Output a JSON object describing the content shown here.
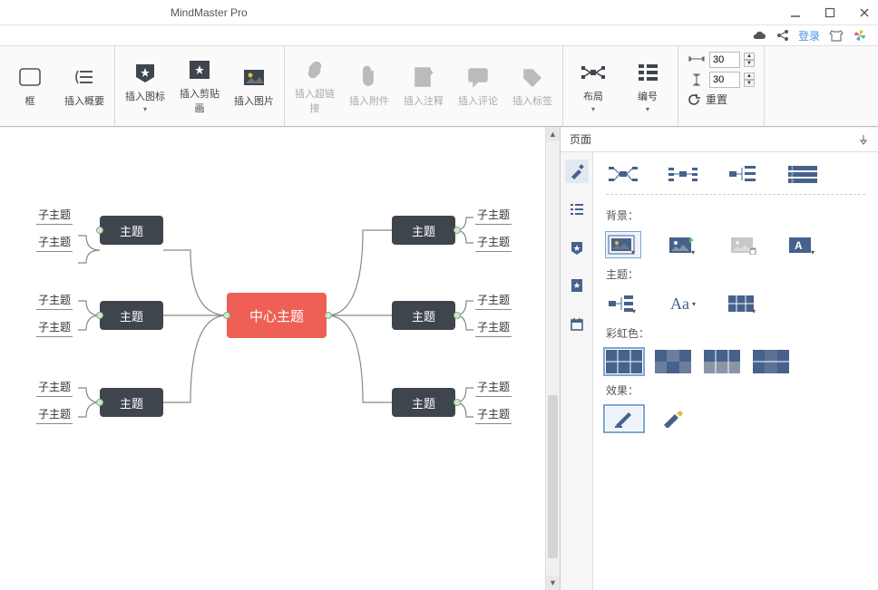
{
  "app": {
    "title": "MindMaster Pro"
  },
  "login_label": "登录",
  "ribbon": {
    "g1": {
      "frame": "框",
      "summary": "插入概要"
    },
    "g2": {
      "icon": "插入图标",
      "clipart": "插入剪贴画",
      "image": "插入图片"
    },
    "g3": {
      "hyperlink": "插入超链接",
      "attach": "插入附件",
      "note": "插入注释",
      "comment": "插入评论",
      "tag": "插入标签"
    },
    "g4": {
      "layout": "布局",
      "number": "编号"
    },
    "g5": {
      "hspace": "30",
      "vspace": "30",
      "reset": "重置"
    }
  },
  "mindmap": {
    "center": "中心主题",
    "topic": "主题",
    "subtopic": "子主题"
  },
  "side": {
    "panel_title": "页面",
    "bg_label": "背景：",
    "theme_label": "主题：",
    "rainbow_label": "彩虹色：",
    "effect_label": "效果：",
    "font_sample": "Aa"
  }
}
